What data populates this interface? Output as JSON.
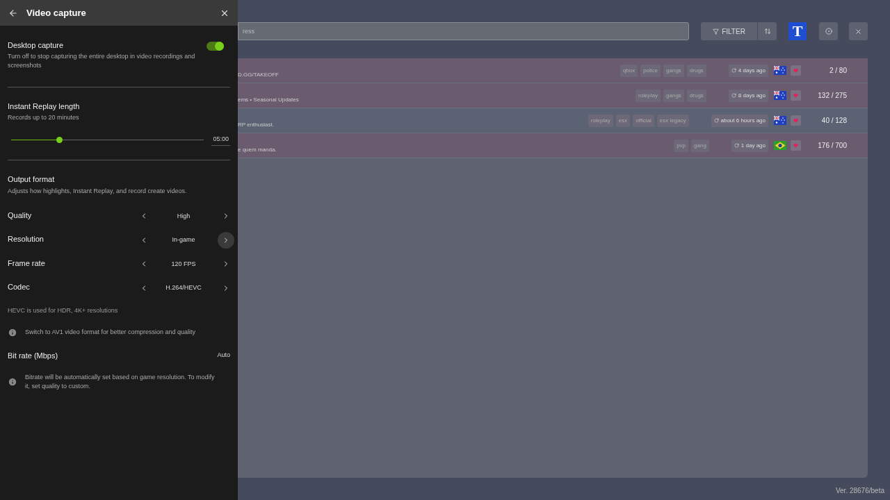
{
  "panel": {
    "title": "Video capture",
    "desktop_capture": {
      "label": "Desktop capture",
      "description": "Turn off to stop capturing the entire desktop in video recordings and screenshots",
      "on": true
    },
    "instant_replay": {
      "label": "Instant Replay length",
      "description": "Records up to 20 minutes",
      "level": 0.25,
      "reading": "05:00"
    },
    "output_format": {
      "label": "Output format",
      "description": "Adjusts how highlights, Instant Replay, and record create videos."
    },
    "selectors": [
      {
        "label": "Quality",
        "value": "High",
        "hovered": false
      },
      {
        "label": "Resolution",
        "value": "In-game",
        "hovered": true
      },
      {
        "label": "Frame rate",
        "value": "120 FPS",
        "hovered": false
      },
      {
        "label": "Codec",
        "value": "H.264/HEVC",
        "hovered": false
      }
    ],
    "codec_note": "HEVC is used for HDR, 4K+ resolutions",
    "av1_tip": "Switch to AV1 video format for better compression and quality",
    "bitrate": {
      "label": "Bit rate (Mbps)",
      "value": "Auto"
    },
    "bitrate_tip": "Bitrate will be automatically set based on game resolution. To modify it, set quality to custom."
  },
  "toolbar": {
    "search_placeholder": "ress",
    "filter": "FILTER",
    "profile_badge": "T"
  },
  "servers": [
    {
      "description": "D.GG/TAKEOFF",
      "tags": [
        "qbox",
        "police",
        "gangs",
        "drugs"
      ],
      "updated": "4 days ago",
      "flag": {
        "kind": "au"
      },
      "players": "2 / 80",
      "highlighted": false
    },
    {
      "description": "ems • Seasonal Updates",
      "tags": [
        "roleplay",
        "gangs",
        "drugs"
      ],
      "updated": "8 days ago",
      "flag": {
        "kind": "au"
      },
      "players": "132 / 275",
      "highlighted": false
    },
    {
      "description": "RP enthusiast.",
      "tags": [
        "roleplay",
        "esx",
        "official",
        "esx legacy"
      ],
      "updated": "about 6 hours ago",
      "flag": {
        "kind": "au"
      },
      "players": "40 / 128",
      "highlighted": true
    },
    {
      "description": "e quem manda.",
      "tags": [
        "pvp",
        "gang"
      ],
      "updated": "1 day ago",
      "flag": {
        "kind": "br"
      },
      "players": "176 / 700",
      "highlighted": false
    }
  ],
  "version": "Ver. 28676/beta"
}
